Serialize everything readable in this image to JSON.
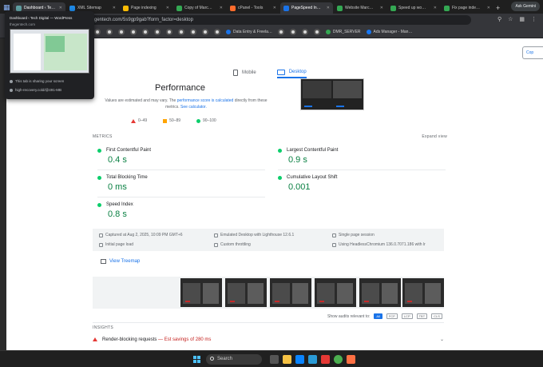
{
  "browser": {
    "tabs": [
      {
        "label": "Dashboard ‹ Te…",
        "color": "#5f9ea0",
        "active": true
      },
      {
        "label": "XML Sitemap",
        "color": "#1e88e5",
        "active": false
      },
      {
        "label": "Page indexing",
        "color": "#fbbc04",
        "active": false
      },
      {
        "label": "Copy of Marc…",
        "color": "#34a853",
        "active": false
      },
      {
        "label": "cPanel - Tools",
        "color": "#ff6c2c",
        "active": false
      },
      {
        "label": "PageSpeed In…",
        "color": "#1a73e8",
        "active": true
      },
      {
        "label": "Website Marc…",
        "color": "#34a853",
        "active": false
      },
      {
        "label": "Speed up wo…",
        "color": "#34a853",
        "active": false
      },
      {
        "label": "Fix page inde…",
        "color": "#34a853",
        "active": false
      }
    ],
    "new_tab": "+",
    "profile_button": "Ask Gemini",
    "url": "gentech.com/5s9gp9gab?form_factor=desktop",
    "bookmarks": [
      {
        "label": "Data Entry & Freela…",
        "color": "#1a73e8"
      },
      {
        "label": "DMR_SERVER",
        "color": "#34a853"
      },
      {
        "label": "Ads Manager - Man…",
        "color": "#1877f2"
      }
    ]
  },
  "share_popup": {
    "title": "Dashboard ‹ Tech Digital — WordPress",
    "subtitle": "thegentech.com",
    "line1": "This tab is sharing your screen",
    "line2": "high-recovery.cold/@491-MB"
  },
  "page": {
    "copy_label": "Cop",
    "device_tabs": {
      "mobile": "Mobile",
      "desktop": "Desktop"
    },
    "performance": {
      "title": "Performance",
      "note_before": "Values are estimated and may vary. The ",
      "note_link1": "performance score is calculated",
      "note_middle": " directly from these metrics. ",
      "note_link2": "See calculator."
    },
    "legend": {
      "fail": "0–49",
      "average": "50–89",
      "pass": "90–100"
    },
    "metrics_header": "METRICS",
    "expand_view": "Expand view",
    "metrics": [
      {
        "name": "First Contentful Paint",
        "value": "0.4 s"
      },
      {
        "name": "Largest Contentful Paint",
        "value": "0.9 s"
      },
      {
        "name": "Total Blocking Time",
        "value": "0 ms"
      },
      {
        "name": "Cumulative Layout Shift",
        "value": "0.001"
      },
      {
        "name": "Speed Index",
        "value": "0.8 s"
      }
    ],
    "info": {
      "captured": "Captured at Aug 2, 2025, 10:09 PM GMT+6",
      "emulated": "Emulated Desktop with Lighthouse 12.6.1",
      "session": "Single page session",
      "initial": "Initial page load",
      "throttling": "Custom throttling",
      "browser": "Using HeadlessChromium 136.0.7071.186 with lr"
    },
    "treemap": "View Treemap",
    "audits": {
      "label": "Show audits relevant to:",
      "chips": [
        "All",
        "FCP",
        "LCP",
        "TBT",
        "CLS"
      ]
    },
    "insights_header": "INSIGHTS",
    "insight": {
      "name": "Render-blocking requests",
      "sep": " — ",
      "savings": "Est savings of 280 ms"
    }
  },
  "taskbar": {
    "search": "Search"
  },
  "colors": {
    "pass": "#0cce6b",
    "average": "#ffa400",
    "fail": "#e53935",
    "link": "#1a73e8"
  }
}
